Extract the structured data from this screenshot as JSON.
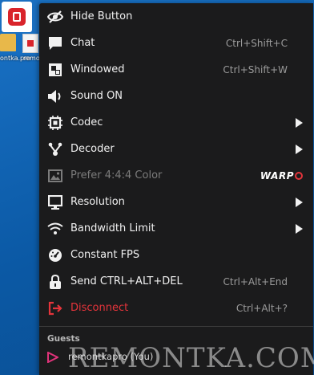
{
  "desktop": {
    "labels": [
      "ontka.pro",
      "remo"
    ]
  },
  "menu": {
    "items": [
      {
        "label": "Hide Button",
        "shortcut": "",
        "submenu": false,
        "icon": "eye-off-icon"
      },
      {
        "label": "Chat",
        "shortcut": "Ctrl+Shift+C",
        "submenu": false,
        "icon": "chat-icon"
      },
      {
        "label": "Windowed",
        "shortcut": "Ctrl+Shift+W",
        "submenu": false,
        "icon": "windowed-icon"
      },
      {
        "label": "Sound ON",
        "shortcut": "",
        "submenu": false,
        "icon": "speaker-icon"
      },
      {
        "label": "Codec",
        "shortcut": "",
        "submenu": true,
        "icon": "chip-icon"
      },
      {
        "label": "Decoder",
        "shortcut": "",
        "submenu": true,
        "icon": "decoder-icon"
      },
      {
        "label": "Prefer 4:4:4 Color",
        "shortcut": "",
        "submenu": false,
        "icon": "image-icon",
        "disabled": true,
        "badge": "WARP"
      },
      {
        "label": "Resolution",
        "shortcut": "",
        "submenu": true,
        "icon": "monitor-icon"
      },
      {
        "label": "Bandwidth Limit",
        "shortcut": "",
        "submenu": true,
        "icon": "wifi-icon"
      },
      {
        "label": "Constant FPS",
        "shortcut": "",
        "submenu": false,
        "icon": "speedometer-icon"
      },
      {
        "label": "Send CTRL+ALT+DEL",
        "shortcut": "Ctrl+Alt+End",
        "submenu": false,
        "icon": "lock-icon"
      },
      {
        "label": "Disconnect",
        "shortcut": "Ctrl+Alt+?",
        "submenu": false,
        "icon": "disconnect-icon",
        "danger": true
      }
    ],
    "guests_header": "Guests",
    "guest_name": "remontkapro (You)"
  },
  "watermark": "REMONTKA.COM",
  "colors": {
    "menu_bg": "#1b1b1c",
    "text": "#f1f1f1",
    "muted": "#9b9b9b",
    "danger": "#e5343b",
    "guest_icon": "#e0337a"
  }
}
